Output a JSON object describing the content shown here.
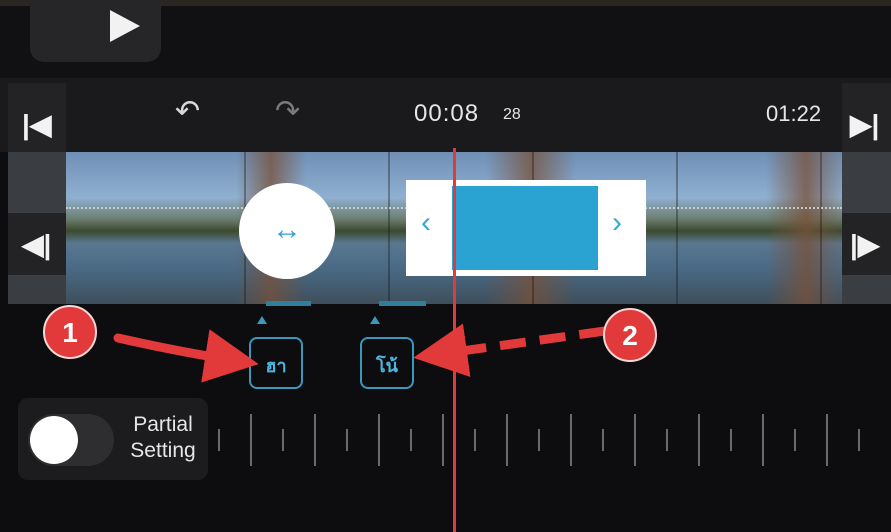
{
  "transport": {
    "current_time": "00:08",
    "current_frames": "28",
    "total_time": "01:22"
  },
  "markers": [
    {
      "label": "ฮา"
    },
    {
      "label": "โน้"
    }
  ],
  "annotations": [
    {
      "number": "1"
    },
    {
      "number": "2"
    }
  ],
  "partial_setting": {
    "label_line1": "Partial",
    "label_line2": "Setting",
    "enabled": false
  },
  "icons": {
    "play": "play-icon",
    "skip_start": "skip-to-start-icon",
    "skip_end": "skip-to-end-icon",
    "undo": "undo-icon",
    "redo": "redo-icon",
    "step_back": "step-back-icon",
    "step_forward": "step-forward-icon",
    "move_handle": "horizontal-move-icon"
  },
  "colors": {
    "accent": "#2aa3d3",
    "playhead": "#e03b3b",
    "annotation": "#e23a3a"
  }
}
